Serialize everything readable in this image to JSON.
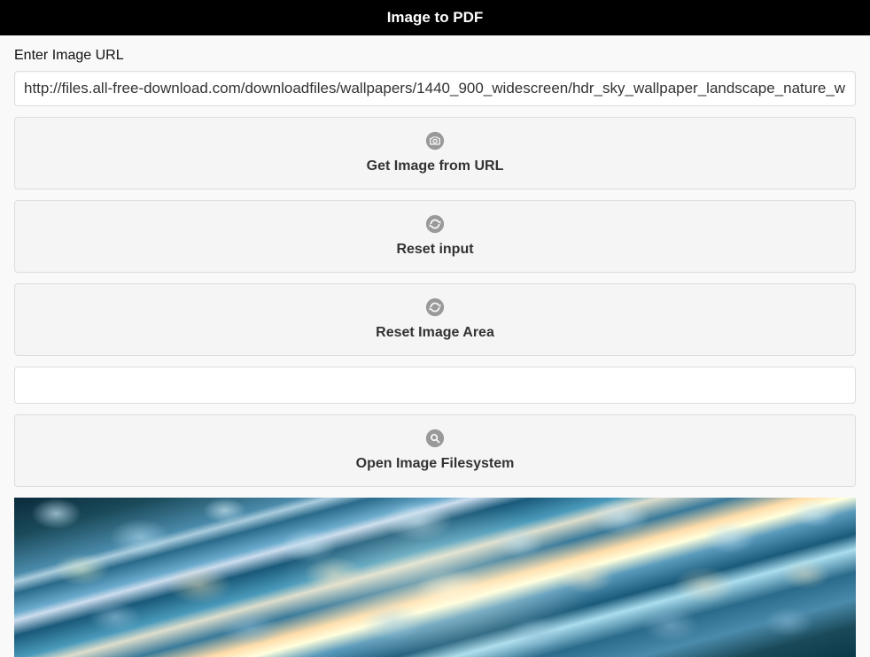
{
  "header": {
    "title": "Image to PDF"
  },
  "form": {
    "url_label": "Enter Image URL",
    "url_value": "http://files.all-free-download.com/downloadfiles/wallpapers/1440_900_widescreen/hdr_sky_wallpaper_landscape_nature_wallpaper_"
  },
  "buttons": {
    "get_image": "Get Image from URL",
    "reset_input": "Reset input",
    "reset_area": "Reset Image Area",
    "open_filesystem": "Open Image Filesystem"
  },
  "icons": {
    "camera": "camera-icon",
    "refresh": "refresh-icon",
    "search": "search-icon"
  }
}
